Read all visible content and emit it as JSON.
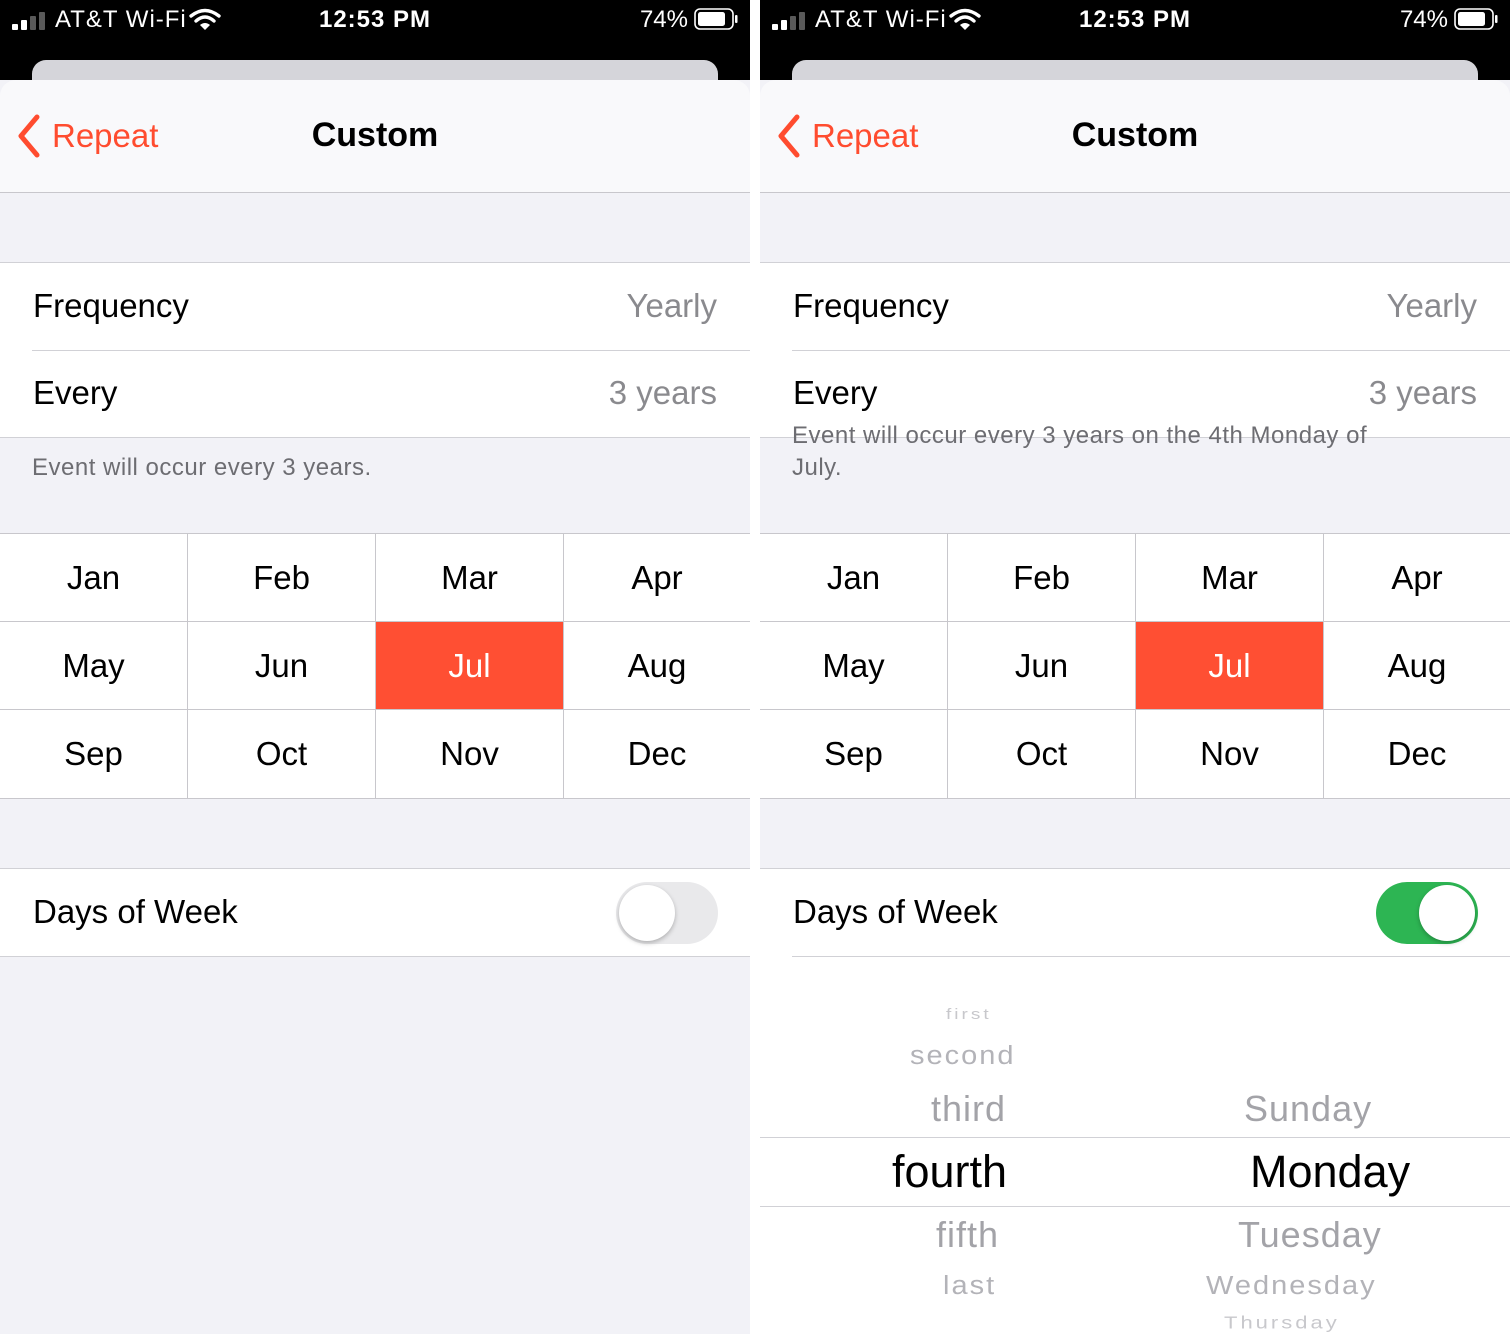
{
  "status": {
    "carrier": "AT&T Wi-Fi",
    "time": "12:53 PM",
    "battery_pct": "74%"
  },
  "nav": {
    "back_label": "Repeat",
    "title": "Custom"
  },
  "accent_color": "#ff4f33",
  "toggle_on_color": "#2db553",
  "months": [
    "Jan",
    "Feb",
    "Mar",
    "Apr",
    "May",
    "Jun",
    "Jul",
    "Aug",
    "Sep",
    "Oct",
    "Nov",
    "Dec"
  ],
  "selected_month": "Jul",
  "left": {
    "frequency": {
      "label": "Frequency",
      "value": "Yearly"
    },
    "every": {
      "label": "Every",
      "value": "3 years"
    },
    "summary": "Event will occur every 3 years.",
    "days_of_week": {
      "label": "Days of Week",
      "enabled": false
    }
  },
  "right": {
    "frequency": {
      "label": "Frequency",
      "value": "Yearly"
    },
    "every": {
      "label": "Every",
      "value": "3 years"
    },
    "summary": "Event will occur every 3 years on the 4th Monday of July.",
    "days_of_week": {
      "label": "Days of Week",
      "enabled": true
    },
    "picker": {
      "ordinal_items": [
        "first",
        "second",
        "third",
        "fourth",
        "fifth",
        "last"
      ],
      "ordinal_selected": "fourth",
      "day_items": [
        "Sunday",
        "Monday",
        "Tuesday",
        "Wednesday",
        "Thursday"
      ],
      "day_selected": "Monday"
    }
  }
}
